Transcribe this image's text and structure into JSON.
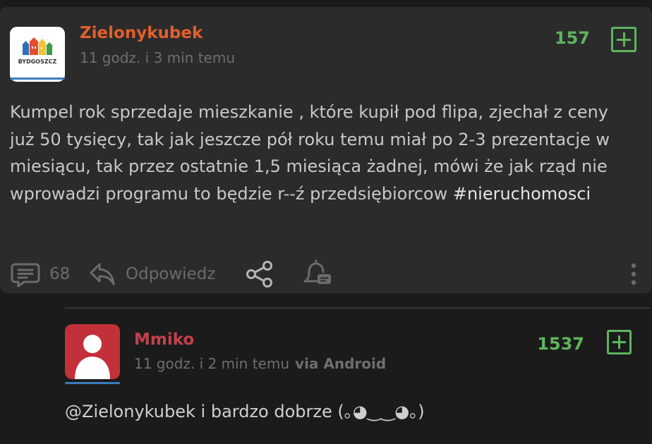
{
  "post": {
    "author": "Zielonykubek",
    "author_color": "#e0602a",
    "avatar_text": "BYDGOSZCZ",
    "time": "11 godz. i 3 min temu",
    "score": "157",
    "body": "Kumpel rok sprzedaje mieszkanie , które kupił pod flipa, zjechał z ceny już 50 tysięcy, tak jak jeszcze pół roku temu miał po 2-3 prezentacje w miesiącu, tak przez ostatnie 1,5 miesiąca żadnej, mówi że jak rząd nie wprowadzi programu to będzie r--ź przedsiębiorcow ",
    "hashtag": "#nieruchomosci",
    "comment_count": "68",
    "reply_label": "Odpowiedz"
  },
  "reply": {
    "author": "Mmiko",
    "author_color": "#c3404a",
    "time": "11 godz. i 2 min temu",
    "via": "via Android",
    "score": "1537",
    "body": "@Zielonykubek i bardzo dobrze (｡◕‿‿◕｡)"
  },
  "colors": {
    "score": "#5db55d",
    "accent_line": "#3b7bbf"
  }
}
